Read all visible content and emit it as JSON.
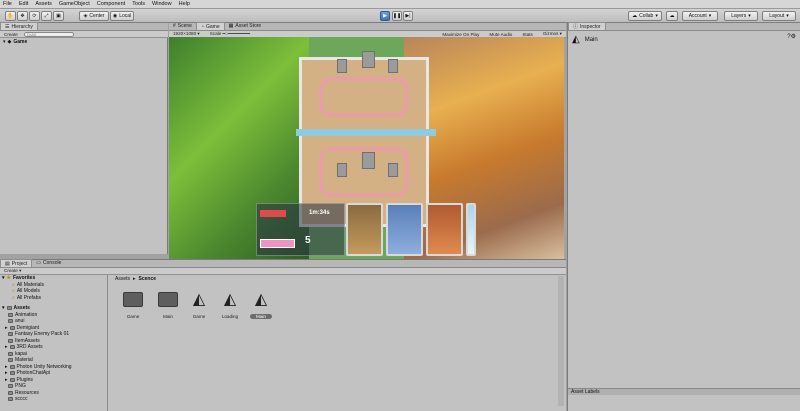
{
  "menu": [
    "File",
    "Edit",
    "Assets",
    "GameObject",
    "Component",
    "Tools",
    "Window",
    "Help"
  ],
  "toolbar": {
    "pivot": "Center",
    "space": "Local",
    "collab": "Collab",
    "account": "Account",
    "layers": "Layers",
    "layout": "Layout"
  },
  "hierarchy": {
    "tab": "Hierarchy",
    "create": "Create",
    "search_placeholder": "Q•All",
    "root": "Game"
  },
  "viewtabs": [
    "Scene",
    "Game",
    "Asset Store"
  ],
  "gamebar": {
    "resolution": "1920×1080",
    "scale_label": "Scale",
    "options": [
      "Maximize On Play",
      "Mute Audio",
      "Stats",
      "Gizmos"
    ]
  },
  "hud": {
    "timer": "1m:34s",
    "elixir": "5"
  },
  "inspector": {
    "tab": "Inspector",
    "object_name": "Main",
    "asset_labels": "Asset Labels"
  },
  "project": {
    "tabs": [
      "Project",
      "Console"
    ],
    "create": "Create",
    "favorites_label": "Favorites",
    "favorites": [
      "All Materials",
      "All Models",
      "All Prefabs"
    ],
    "assets_label": "Assets",
    "folders": [
      "Animation",
      "anui",
      "Demigiant",
      "Fantasy Enemy Pack 01",
      "ItemAssets",
      "3RD Assets",
      "kapai",
      "Material",
      "Photon Unity Networking",
      "PhotonChatApi",
      "Plugins",
      "PNG",
      "Resources",
      "scccc"
    ],
    "breadcrumb": [
      "Assets",
      "Scence"
    ],
    "grid": [
      {
        "name": "Game",
        "type": "folder"
      },
      {
        "name": "Main",
        "type": "folder"
      },
      {
        "name": "Game",
        "type": "scene"
      },
      {
        "name": "Loading",
        "type": "scene"
      },
      {
        "name": "Main",
        "type": "scene"
      }
    ]
  },
  "colors": {
    "play_blue": "#4a7fc1",
    "folder_yellow": "#c9a227"
  }
}
